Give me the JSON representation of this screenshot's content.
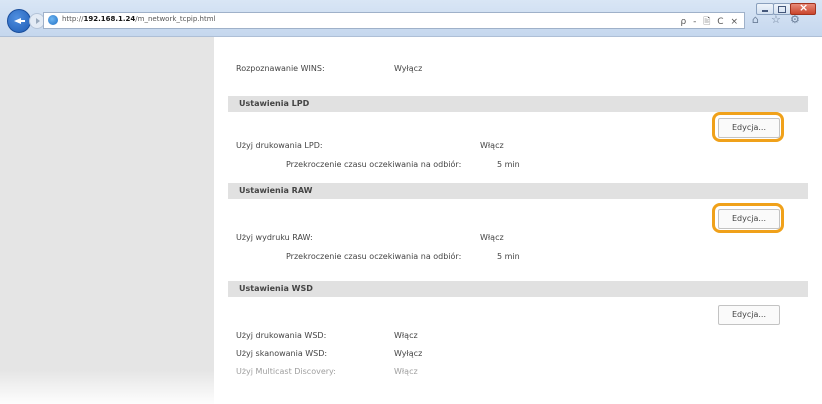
{
  "browser": {
    "url_prefix": "http://",
    "url_host": "192.168.1.24",
    "url_path": "/m_network_tcpip.html",
    "addr_controls": "ρ - 🖹 C ×"
  },
  "top_row": {
    "label": "Rozpoznawanie WINS:",
    "value": "Wyłącz"
  },
  "sections": [
    {
      "title": "Ustawienia LPD",
      "edit_label": "Edycja...",
      "rows": [
        {
          "label": "Użyj drukowania LPD:",
          "value": "Włącz"
        },
        {
          "label": "Przekroczenie czasu oczekiwania na odbiór:",
          "value": "5 min"
        }
      ]
    },
    {
      "title": "Ustawienia RAW",
      "edit_label": "Edycja...",
      "rows": [
        {
          "label": "Użyj wydruku RAW:",
          "value": "Włącz"
        },
        {
          "label": "Przekroczenie czasu oczekiwania na odbiór:",
          "value": "5 min"
        }
      ]
    },
    {
      "title": "Ustawienia WSD",
      "edit_label": "Edycja...",
      "rows": [
        {
          "label": "Użyj drukowania WSD:",
          "value": "Włącz"
        },
        {
          "label": "Użyj skanowania WSD:",
          "value": "Wyłącz"
        },
        {
          "label": "Użyj Multicast Discovery:",
          "value": "Włącz"
        }
      ]
    }
  ],
  "colors": {
    "highlight": "#f0a11a",
    "section_bg": "#e1e1e1",
    "left_panel": "#e5e5e5"
  }
}
